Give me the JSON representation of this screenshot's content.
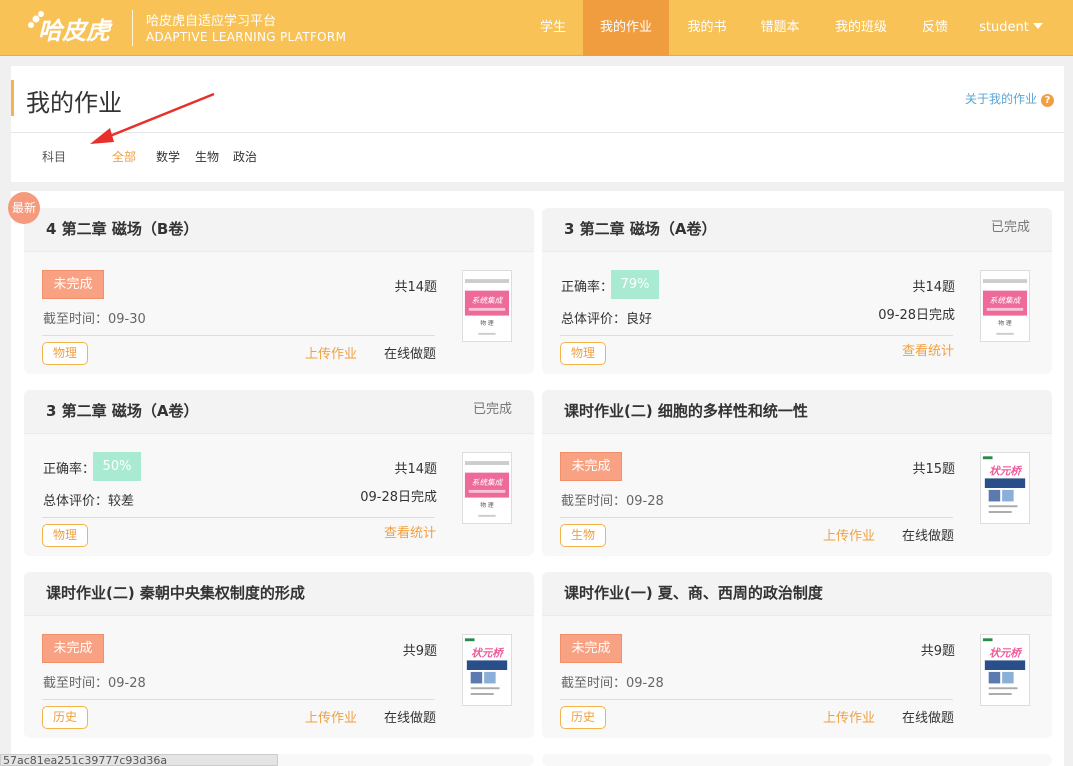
{
  "brand": {
    "cn": "哈皮虎自适应学习平台",
    "en": "ADAPTIVE LEARNING PLATFORM",
    "logo_text": "哈皮虎"
  },
  "nav": {
    "items": [
      "学生",
      "我的作业",
      "我的书",
      "错题本",
      "我的班级",
      "反馈",
      "student"
    ],
    "active": "我的作业"
  },
  "page": {
    "title": "我的作业",
    "about": "关于我的作业",
    "help_icon": "?"
  },
  "filters": {
    "label": "科目",
    "items": [
      "全部",
      "数学",
      "生物",
      "政治"
    ],
    "active": "全部"
  },
  "new_badge": "最新",
  "labels": {
    "not_done": "未完成",
    "done": "已完成",
    "deadline_prefix": "截至时间：",
    "accuracy": "正确率：",
    "evaluation_prefix": "总体评价：",
    "upload": "上传作业",
    "online": "在线做题",
    "stats": "查看统计"
  },
  "cards": [
    {
      "title": "4 第二章 磁场（B卷）",
      "status": "未完成",
      "deadline": "09-30",
      "count": "共14题",
      "subject": "物理"
    },
    {
      "title": "3 第二章 磁场（A卷）",
      "status": "已完成",
      "accuracy": "79%",
      "evaluation": "良好",
      "count": "共14题",
      "done_date": "09-28日完成",
      "subject": "物理"
    },
    {
      "title": "3 第二章 磁场（A卷）",
      "status": "已完成",
      "accuracy": "50%",
      "evaluation": "较差",
      "count": "共14题",
      "done_date": "09-28日完成",
      "subject": "物理"
    },
    {
      "title": "课时作业(二) 细胞的多样性和统一性",
      "status": "未完成",
      "deadline": "09-28",
      "count": "共15题",
      "subject": "生物"
    },
    {
      "title": "课时作业(二) 秦朝中央集权制度的形成",
      "status": "未完成",
      "deadline": "09-28",
      "count": "共9题",
      "subject": "历史"
    },
    {
      "title": "课时作业(一) 夏、商、西周的政治制度",
      "status": "未完成",
      "deadline": "09-28",
      "count": "共9题",
      "subject": "历史"
    }
  ],
  "book_covers": {
    "physics": "系统集成",
    "generic": "状元桥"
  },
  "status_url": "57ac81ea251c39777c93d36a",
  "colors": {
    "brand": "#f8c256",
    "active_nav": "#f09d40",
    "accent": "#f0a040",
    "not_done": "#f8a283",
    "accuracy": "#a9ead3"
  }
}
